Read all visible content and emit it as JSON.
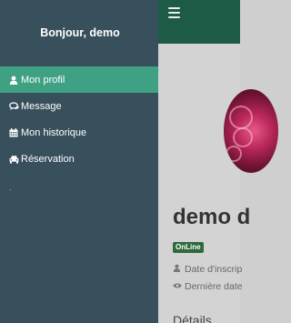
{
  "drawer": {
    "greeting": "Bonjour, demo",
    "items": [
      {
        "label": "Mon profil",
        "icon": "user-icon",
        "active": true
      },
      {
        "label": "Message",
        "icon": "comments-icon",
        "active": false
      },
      {
        "label": "Mon historique",
        "icon": "calendar-icon",
        "active": false
      },
      {
        "label": "Réservation",
        "icon": "car-icon",
        "active": false
      }
    ],
    "stray_mark": "-"
  },
  "topbar": {
    "menu_icon": "hamburger-icon"
  },
  "profile": {
    "name_visible": "demo d",
    "status_badge": "OnLine",
    "date_inscription_label": "Date d'inscrip",
    "derniere_date_label": "Dernière date",
    "details_heading": "Détails"
  },
  "colors": {
    "drawer_bg": "#37505c",
    "active_item": "#3fa183",
    "topbar": "#1e5b46",
    "badge": "#2e6a3c"
  }
}
